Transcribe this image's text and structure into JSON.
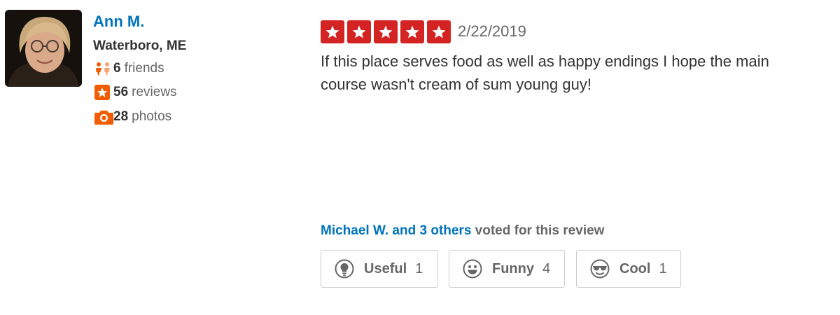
{
  "user": {
    "name": "Ann M.",
    "location": "Waterboro, ME",
    "stats": [
      {
        "icon": "friends-icon",
        "count": "6",
        "label": "friends"
      },
      {
        "icon": "review-star-icon",
        "count": "56",
        "label": "reviews"
      },
      {
        "icon": "camera-icon",
        "count": "28",
        "label": "photos"
      }
    ]
  },
  "review": {
    "rating": 5,
    "max_rating": 5,
    "date": "2/22/2019",
    "text": "If this place serves food as well as happy endings I hope the main course wasn't cream of sum young guy!"
  },
  "votes": {
    "voters": "Michael W. and 3 others",
    "suffix": " voted for this review",
    "buttons": [
      {
        "icon": "lightbulb-icon",
        "label": "Useful",
        "count": "1"
      },
      {
        "icon": "smiley-icon",
        "label": "Funny",
        "count": "4"
      },
      {
        "icon": "sunglasses-icon",
        "label": "Cool",
        "count": "1"
      }
    ]
  },
  "colors": {
    "link": "#0073bb",
    "star_red": "#d32323",
    "stat_orange": "#f15c00",
    "text": "#333333",
    "muted": "#666666"
  }
}
